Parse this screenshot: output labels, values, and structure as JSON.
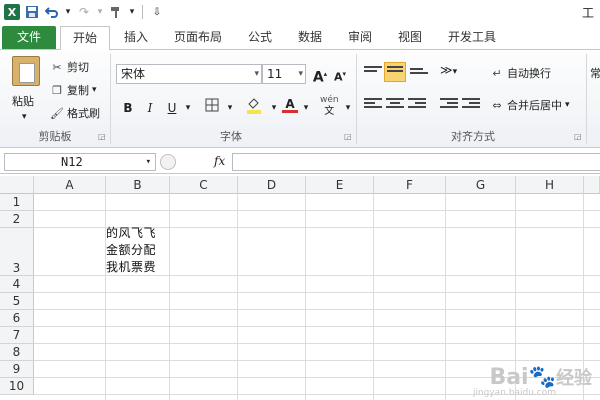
{
  "window": {
    "title_fragment": "工"
  },
  "quick_access": {
    "icons": [
      "excel-icon",
      "save-icon",
      "undo-icon",
      "redo-icon",
      "format-painter-icon",
      "customize-icon"
    ],
    "undo_arrow": "▾",
    "excel_glyph": "X"
  },
  "tabs": [
    {
      "label": "文件"
    },
    {
      "label": "开始"
    },
    {
      "label": "插入"
    },
    {
      "label": "页面布局"
    },
    {
      "label": "公式"
    },
    {
      "label": "数据"
    },
    {
      "label": "审阅"
    },
    {
      "label": "视图"
    },
    {
      "label": "开发工具"
    }
  ],
  "ribbon": {
    "clipboard": {
      "paste_label": "粘贴",
      "cut_label": "剪切",
      "copy_label": "复制",
      "format_painter_label": "格式刷",
      "group_label": "剪贴板"
    },
    "font": {
      "font_name": "宋体",
      "font_size": "11",
      "grow_label": "A",
      "shrink_label": "A",
      "bold_label": "B",
      "italic_label": "I",
      "underline_label": "U",
      "phonetic_label": "wén",
      "group_label": "字体",
      "highlight_color": "#f9e14a",
      "font_color": "#d62f2f"
    },
    "alignment": {
      "wrap_text_label": "自动换行",
      "merge_center_label": "合并后居中",
      "group_label": "对齐方式",
      "active_align_color": "#f9d36f"
    },
    "number_fragment": "常"
  },
  "formula_bar": {
    "name_box": "N12",
    "fx_label": "fx",
    "formula": ""
  },
  "sheet": {
    "columns": [
      "A",
      "B",
      "C",
      "D",
      "E",
      "F",
      "G",
      "H"
    ],
    "rows": [
      "1",
      "2",
      "3",
      "4",
      "5",
      "6",
      "7",
      "8",
      "9",
      "10"
    ],
    "cell_b3_lines": [
      "的风飞飞",
      "金额分配",
      "我机票费"
    ]
  },
  "watermark": {
    "brand": "Bai",
    "brand2": "经验",
    "sub": "jingyan.baidu.com"
  }
}
